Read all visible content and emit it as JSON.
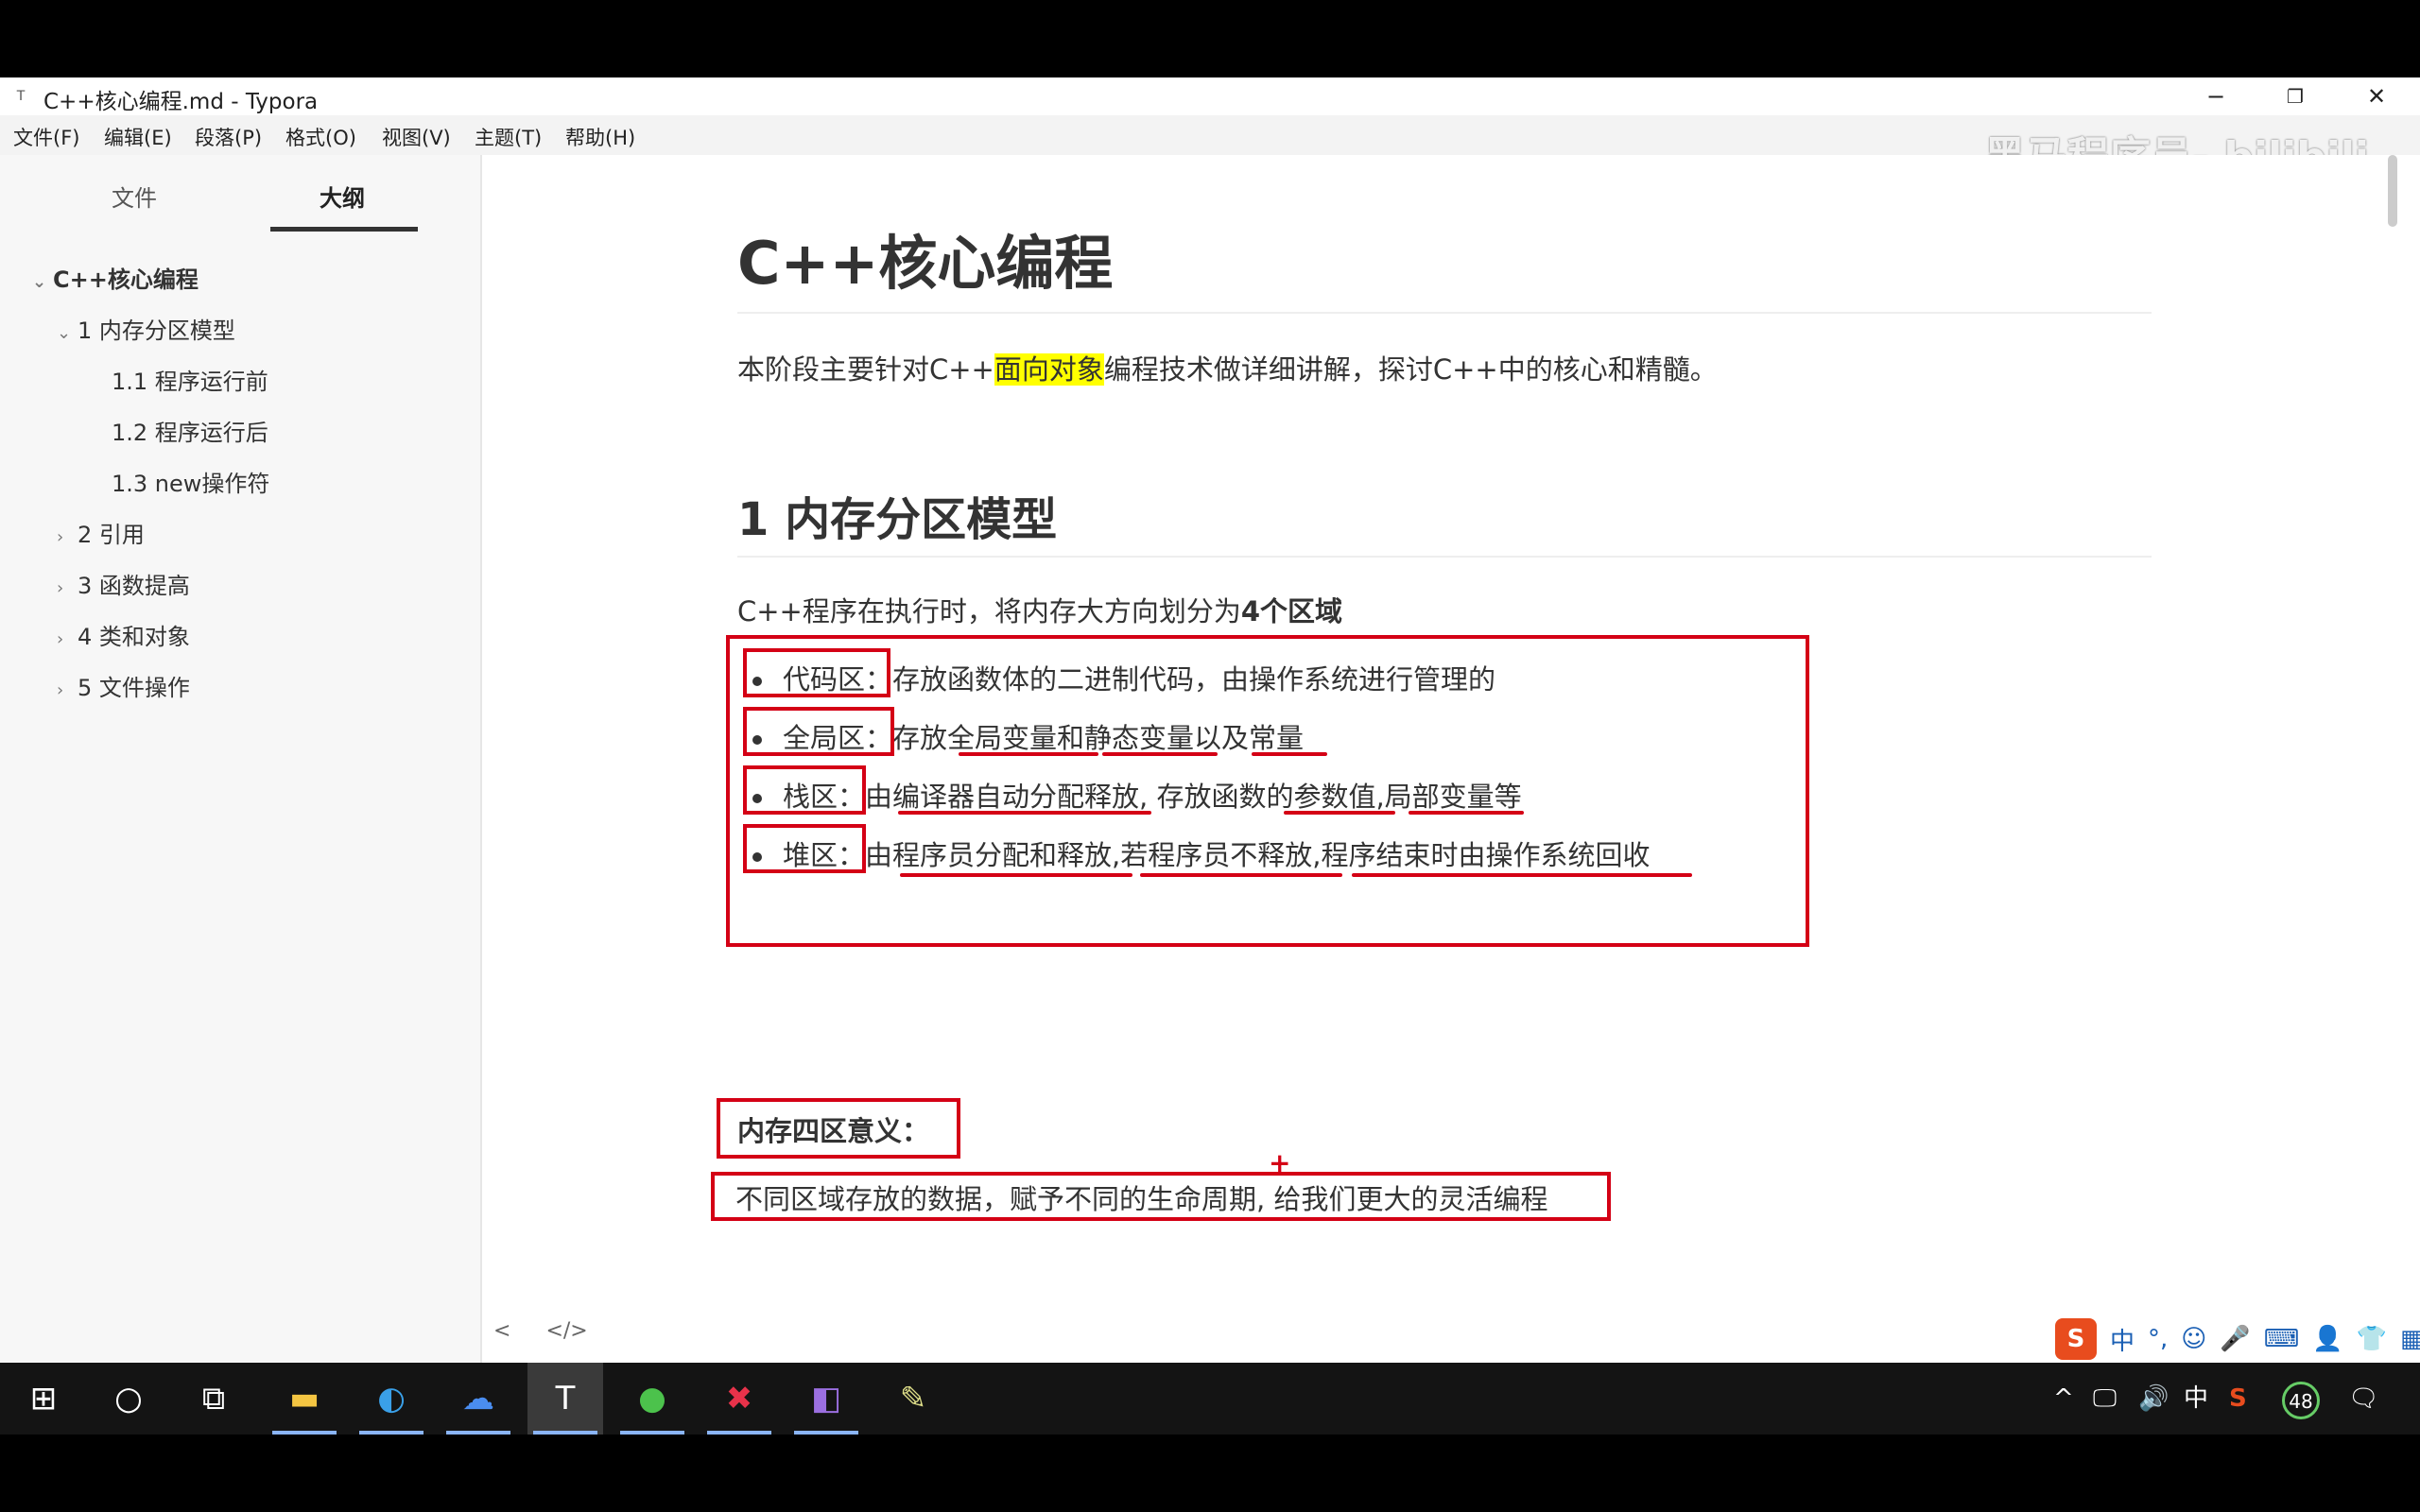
{
  "window": {
    "title": "C++核心编程.md - Typora",
    "app_icon": "T",
    "controls": {
      "minimize": "−",
      "restore": "❐",
      "close": "✕"
    }
  },
  "menu": [
    "文件(F)",
    "编辑(E)",
    "段落(P)",
    "格式(O)",
    "视图(V)",
    "主题(T)",
    "帮助(H)"
  ],
  "watermark": "黑马程序员- bilibili",
  "sidebar": {
    "tabs": [
      "文件",
      "大纲"
    ],
    "active_tab": "大纲",
    "outline": [
      {
        "label": "C++核心编程",
        "level": 0,
        "expanded": true,
        "bold": true
      },
      {
        "label": "1 内存分区模型",
        "level": 1,
        "expanded": true
      },
      {
        "label": "1.1 程序运行前",
        "level": 2
      },
      {
        "label": "1.2 程序运行后",
        "level": 2
      },
      {
        "label": "1.3 new操作符",
        "level": 2
      },
      {
        "label": "2 引用",
        "level": 1,
        "expanded": false
      },
      {
        "label": "3 函数提高",
        "level": 1,
        "expanded": false
      },
      {
        "label": "4 类和对象",
        "level": 1,
        "expanded": false
      },
      {
        "label": "5 文件操作",
        "level": 1,
        "expanded": false
      }
    ]
  },
  "document": {
    "h1": "C++核心编程",
    "intro_before": "本阶段主要针对C++",
    "intro_highlight": "面向对象",
    "intro_after": "编程技术做详细讲解，探讨C++中的核心和精髓。",
    "h2": "1 内存分区模型",
    "section_intro_before": "C++程序在执行时，将内存大方向划分为",
    "section_intro_bold": "4个区域",
    "bullets": [
      {
        "term": "代码区：",
        "text": "存放函数体的二进制代码，由操作系统进行管理的"
      },
      {
        "term": "全局区：",
        "text": "存放全局变量和静态变量以及常量"
      },
      {
        "term": "栈区：",
        "text": "由编译器自动分配释放, 存放函数的参数值,局部变量等"
      },
      {
        "term": "堆区：",
        "text": "由程序员分配和释放,若程序员不释放,程序结束时由操作系统回收"
      }
    ],
    "meaning_title": "内存四区意义：",
    "meaning_text": "不同区域存放的数据，赋予不同的生命周期, 给我们更大的灵活编程"
  },
  "editor_footer": {
    "back": "<",
    "source": "</>"
  },
  "ime": [
    "S",
    "中",
    "°,",
    "☺",
    "🎤",
    "⌨",
    "👤",
    "👕",
    "▦"
  ],
  "taskbar": {
    "apps": [
      "start-icon",
      "search-icon",
      "task-view-icon",
      "file-explorer-icon",
      "edge-icon",
      "baidu-netdisk-icon",
      "typora-icon",
      "green-app-icon",
      "xmind-icon",
      "visual-studio-icon",
      "paint-icon"
    ],
    "tray": {
      "chevron": "^",
      "network": "🖵",
      "volume": "🔊",
      "ime": "中",
      "sogou": "S",
      "battery_badge": "48",
      "notification": "🗨"
    }
  },
  "colors": {
    "annotation_red": "#d40015",
    "highlight": "#ffff00"
  }
}
